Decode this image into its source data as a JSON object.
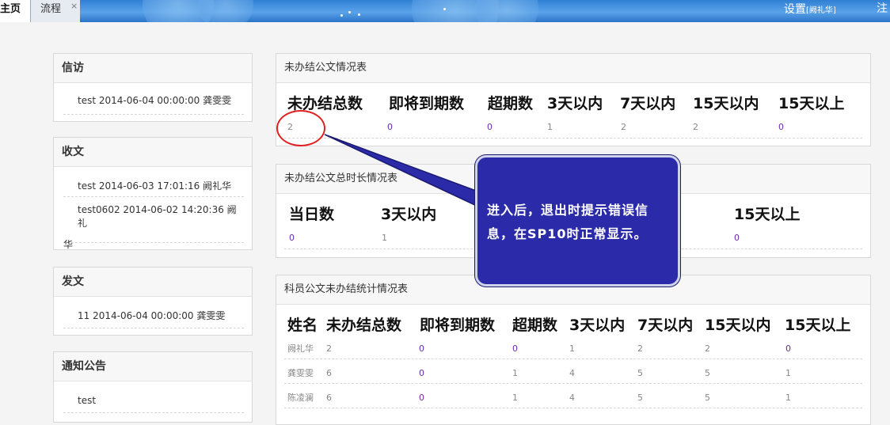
{
  "tabs": {
    "home": "主页",
    "flow": "流程",
    "close": "×"
  },
  "header": {
    "settings": "设置",
    "user": "[阙礼华]",
    "logout": "注"
  },
  "left": {
    "xinfang": {
      "title": "信访",
      "items": [
        "test 2014-06-04 00:00:00 龚雯雯"
      ]
    },
    "shouwen": {
      "title": "收文",
      "items": [
        "test 2014-06-03 17:01:16 阙礼华",
        "test0602 2014-06-02 14:20:36 阙礼",
        "华"
      ]
    },
    "fawen": {
      "title": "发文",
      "items": [
        "11 2014-06-04 00:00:00 龚雯雯"
      ]
    },
    "tongzhi": {
      "title": "通知公告",
      "items": [
        "test"
      ]
    }
  },
  "panel1": {
    "title": "未办结公文情况表",
    "headers": [
      "未办结总数",
      "即将到期数",
      "超期数",
      "3天以内",
      "7天以内",
      "15天以内",
      "15天以上"
    ],
    "values": [
      "2",
      "0",
      "0",
      "1",
      "2",
      "2",
      "0"
    ]
  },
  "panel2": {
    "title": "未办结公文总时长情况表",
    "headers": [
      "当日数",
      "3天以内",
      "15天以上"
    ],
    "values": [
      "0",
      "1",
      "0"
    ]
  },
  "panel3": {
    "title": "科员公文未办结统计情况表",
    "headers": [
      "姓名",
      "未办结总数",
      "即将到期数",
      "超期数",
      "3天以内",
      "7天以内",
      "15天以内",
      "15天以上"
    ],
    "rows": [
      [
        "阙礼华",
        "2",
        "0",
        "0",
        "1",
        "2",
        "2",
        "0"
      ],
      [
        "龚雯雯",
        "6",
        "0",
        "1",
        "4",
        "5",
        "5",
        "1"
      ],
      [
        "陈凌澜",
        "6",
        "0",
        "1",
        "4",
        "5",
        "5",
        "1"
      ]
    ]
  },
  "callout": {
    "text": "进入后，退出时提示错误信息，在SP10时正常显示。"
  }
}
